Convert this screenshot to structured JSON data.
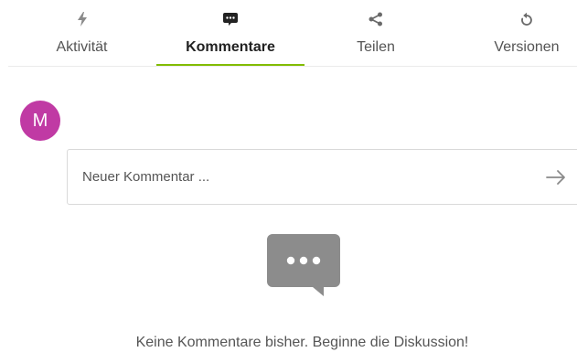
{
  "tabs": [
    {
      "label": "Aktivität",
      "icon": "lightning-icon",
      "active": false
    },
    {
      "label": "Kommentare",
      "icon": "comment-icon",
      "active": true
    },
    {
      "label": "Teilen",
      "icon": "share-icon",
      "active": false
    },
    {
      "label": "Versionen",
      "icon": "history-icon",
      "active": false
    }
  ],
  "avatar": {
    "initial": "M",
    "color": "#c03aa4"
  },
  "comment": {
    "placeholder": "Neuer Kommentar ..."
  },
  "empty": {
    "message": "Keine Kommentare bisher. Beginne die Diskussion!"
  },
  "colors": {
    "accent": "#82bc00",
    "icon": "#9a9a9a"
  }
}
